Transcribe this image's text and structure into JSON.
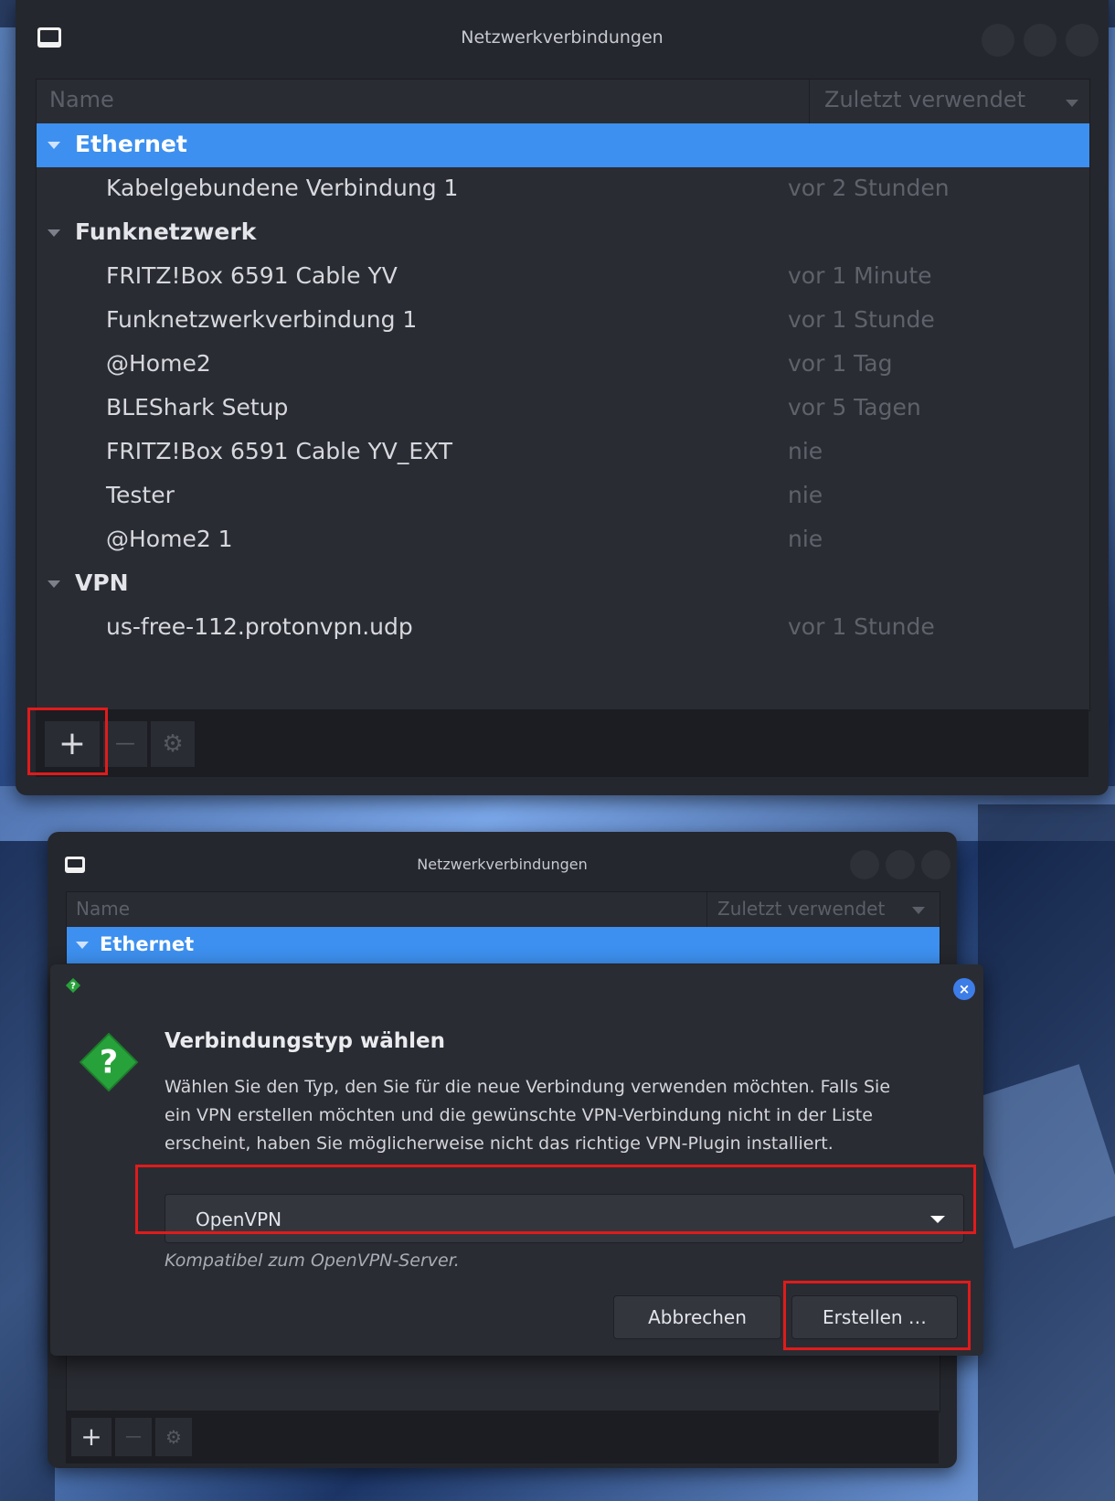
{
  "window": {
    "title": "Netzwerkverbindungen",
    "columns": {
      "name": "Name",
      "last_used": "Zuletzt verwendet"
    }
  },
  "connections": {
    "ethernet": {
      "label": "Ethernet",
      "items": [
        {
          "name": "Kabelgebundene Verbindung 1",
          "when": "vor 2 Stunden"
        }
      ]
    },
    "wifi": {
      "label": "Funknetzwerk",
      "items": [
        {
          "name": "FRITZ!Box 6591 Cable YV",
          "when": "vor 1 Minute"
        },
        {
          "name": "Funknetzwerkverbindung 1",
          "when": "vor 1 Stunde"
        },
        {
          "name": "@Home2",
          "when": "vor 1 Tag"
        },
        {
          "name": "BLEShark Setup",
          "when": "vor 5 Tagen"
        },
        {
          "name": "FRITZ!Box 6591 Cable YV_EXT",
          "when": "nie"
        },
        {
          "name": "Tester",
          "when": "nie"
        },
        {
          "name": "@Home2 1",
          "when": "nie"
        }
      ]
    },
    "vpn": {
      "label": "VPN",
      "items": [
        {
          "name": "us-free-112.protonvpn.udp",
          "when": "vor 1 Stunde"
        }
      ]
    }
  },
  "toolbar": {
    "add": "+",
    "remove": "—",
    "settings": "⚙"
  },
  "dialog": {
    "heading": "Verbindungstyp wählen",
    "description_lines": [
      "Wählen Sie den Typ, den Sie für die neue Verbindung verwenden möchten. Falls Sie",
      "ein VPN erstellen möchten und die gewünschte VPN-Verbindung nicht in der Liste",
      "erscheint, haben Sie möglicherweise nicht das richtige VPN-Plugin installiert."
    ],
    "selected_type": "OpenVPN",
    "hint": "Kompatibel zum OpenVPN-Server.",
    "cancel_label": "Abbrechen",
    "create_label": "Erstellen …"
  },
  "colors": {
    "accent": "#3d90ef",
    "highlight_box": "#e01b1b",
    "question_icon": "#27a23a"
  },
  "icons": {
    "app": "window-icon",
    "dialog_small": "question-diamond-icon",
    "dialog_main": "question-diamond-icon",
    "close": "close-icon",
    "settings": "gear-icon"
  }
}
